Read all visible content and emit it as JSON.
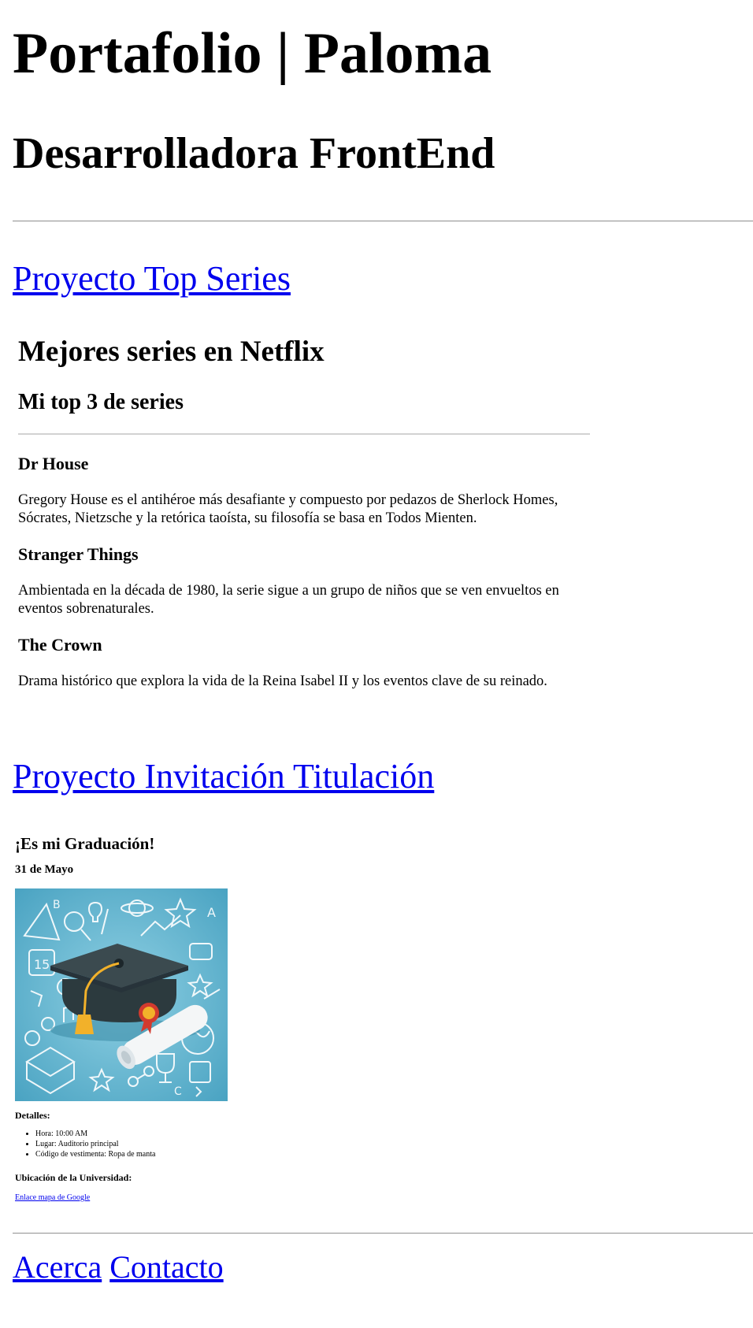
{
  "header": {
    "title": "Portafolio | Paloma",
    "subtitle": "Desarrolladora FrontEnd"
  },
  "projects": {
    "top_series": {
      "link_label": "Proyecto Top Series",
      "title": "Mejores series en Netflix",
      "subtitle": "Mi top 3 de series",
      "series": [
        {
          "name": "Dr House",
          "description": "Gregory House es el antihéroe más desafiante y compuesto por pedazos de Sherlock Homes, Sócrates, Nietzsche y la retórica taoísta, su filosofía se basa en Todos Mienten."
        },
        {
          "name": "Stranger Things",
          "description": "Ambientada en la década de 1980, la serie sigue a un grupo de niños que se ven envueltos en eventos sobrenaturales."
        },
        {
          "name": "The Crown",
          "description": "Drama histórico que explora la vida de la Reina Isabel II y los eventos clave de su reinado."
        }
      ]
    },
    "invitation": {
      "link_label": "Proyecto Invitación Titulación",
      "title": "¡Es mi Graduación!",
      "date": "31 de Mayo",
      "image": {
        "icon": "graduation-cap-diploma-illustration",
        "bg_color": "#4fa9c6"
      },
      "details_title": "Detalles:",
      "details": [
        "Hora: 10:00 AM",
        "Lugar: Auditorio principal",
        "Código de vestimenta: Ropa de manta"
      ],
      "location_title": "Ubicación de la Universidad:",
      "map_link_label": "Enlace mapa de Google"
    }
  },
  "footer": {
    "links": [
      "Acerca",
      "Contacto"
    ]
  },
  "colors": {
    "link": "#0000ee",
    "rule": "#9a9a9a"
  }
}
